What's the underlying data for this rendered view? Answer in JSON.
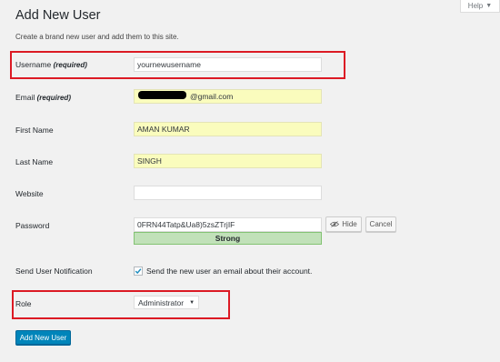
{
  "help": {
    "label": "Help",
    "caret": "▼"
  },
  "page": {
    "title": "Add New User",
    "intro": "Create a brand new user and add them to this site."
  },
  "form": {
    "username": {
      "label": "Username",
      "required": "(required)",
      "value": "yournewusername"
    },
    "email": {
      "label": "Email",
      "required": "(required)",
      "value": "@gmail.com"
    },
    "first_name": {
      "label": "First Name",
      "value": "AMAN KUMAR"
    },
    "last_name": {
      "label": "Last Name",
      "value": "SINGH"
    },
    "website": {
      "label": "Website",
      "value": ""
    },
    "password": {
      "label": "Password",
      "value": "0FRN44Tatp&Ua8)5zsZTrjIF",
      "strength": "Strong",
      "hide_label": "Hide",
      "cancel_label": "Cancel"
    },
    "notification": {
      "label": "Send User Notification",
      "checked": true,
      "text": "Send the new user an email about their account."
    },
    "role": {
      "label": "Role",
      "value": "Administrator",
      "arrow": "▼"
    },
    "submit_label": "Add New User"
  },
  "icons": {
    "eye": "eye-slash-icon",
    "checkmark": "checkmark-icon",
    "help_caret": "caret-down-icon",
    "select_arrow": "caret-down-icon"
  },
  "colors": {
    "highlight": "#dc1a24",
    "primary": "#0085ba",
    "strong": "#c1e1b9",
    "autofill": "#fafcbd"
  }
}
